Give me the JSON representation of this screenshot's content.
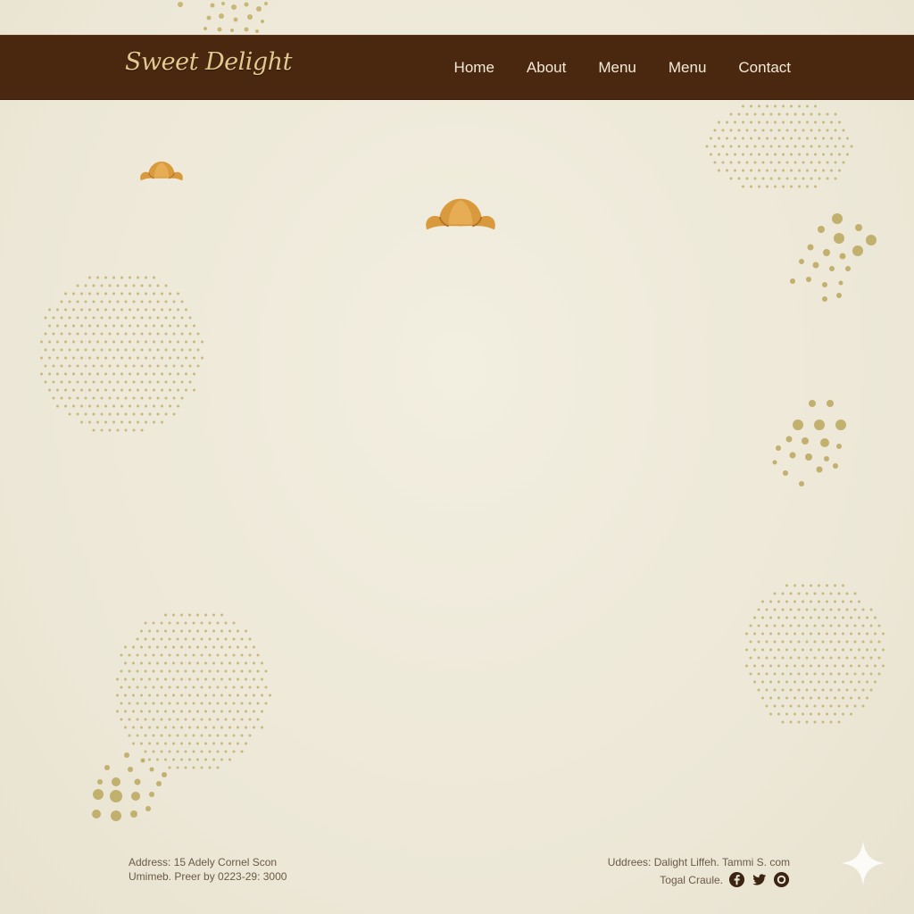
{
  "brand": {
    "name": "Sweet Delight"
  },
  "nav": {
    "items": [
      {
        "label": "Home"
      },
      {
        "label": "About"
      },
      {
        "label": "Menu"
      },
      {
        "label": "Menu"
      },
      {
        "label": "Contact"
      }
    ]
  },
  "footer": {
    "left_line1": "Address: 15 Adely Cornel Scon",
    "left_line2": "Umimeb. Preer by 0223-29: 3000",
    "right_line1": "Uddrees: Dalight Liffeh. Tammi S. com",
    "right_line2": "Togal Craule."
  },
  "icons": {
    "social": [
      "facebook-icon",
      "twitter-icon",
      "instagram-icon"
    ],
    "decor": [
      "croissant-icon",
      "sparkle-icon"
    ]
  },
  "colors": {
    "background": "#efebdc",
    "navbar": "#4a2810",
    "logo": "#e2c98f",
    "nav_text": "#f3ead8",
    "dot_gold": "#c2b06e",
    "croissant": "#d9993f",
    "footer_text": "#6b5a45"
  }
}
